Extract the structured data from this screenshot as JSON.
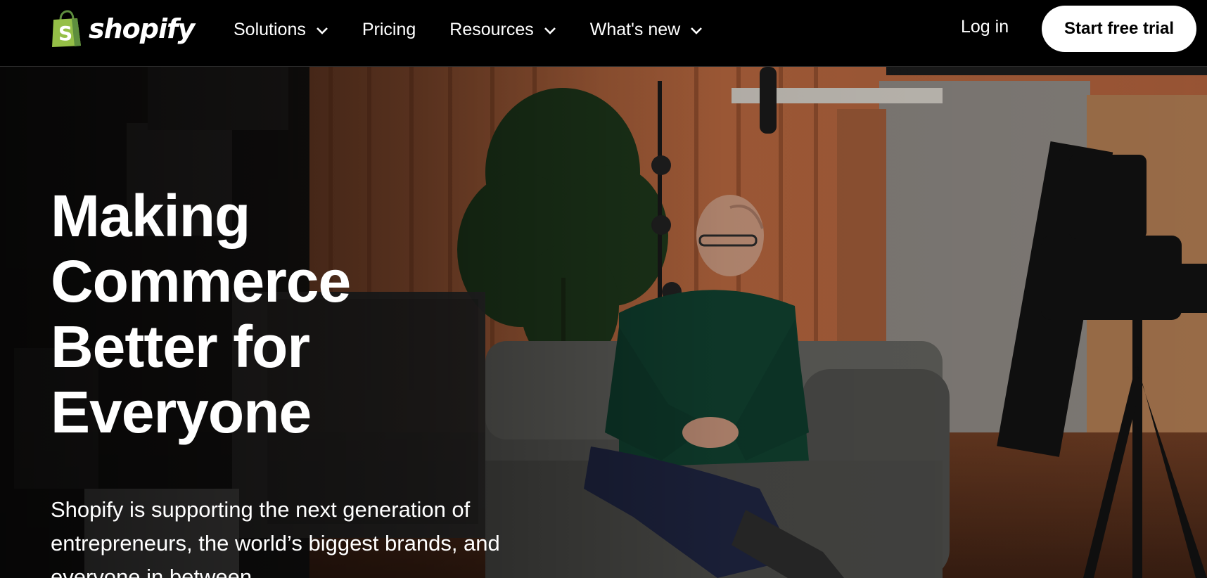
{
  "brand": {
    "name": "shopify",
    "logo_icon": "shopping-bag-icon",
    "accent_color": "#95bf47"
  },
  "nav": {
    "items": [
      {
        "label": "Solutions",
        "has_dropdown": true
      },
      {
        "label": "Pricing",
        "has_dropdown": false
      },
      {
        "label": "Resources",
        "has_dropdown": true
      },
      {
        "label": "What's new",
        "has_dropdown": true
      }
    ],
    "login_label": "Log in",
    "cta_label": "Start free trial"
  },
  "hero": {
    "headline": "Making Commerce Better for Everyone",
    "subtext": "Shopify is supporting the next generation of entrepreneurs, the world’s biggest brands, and everyone in between"
  }
}
